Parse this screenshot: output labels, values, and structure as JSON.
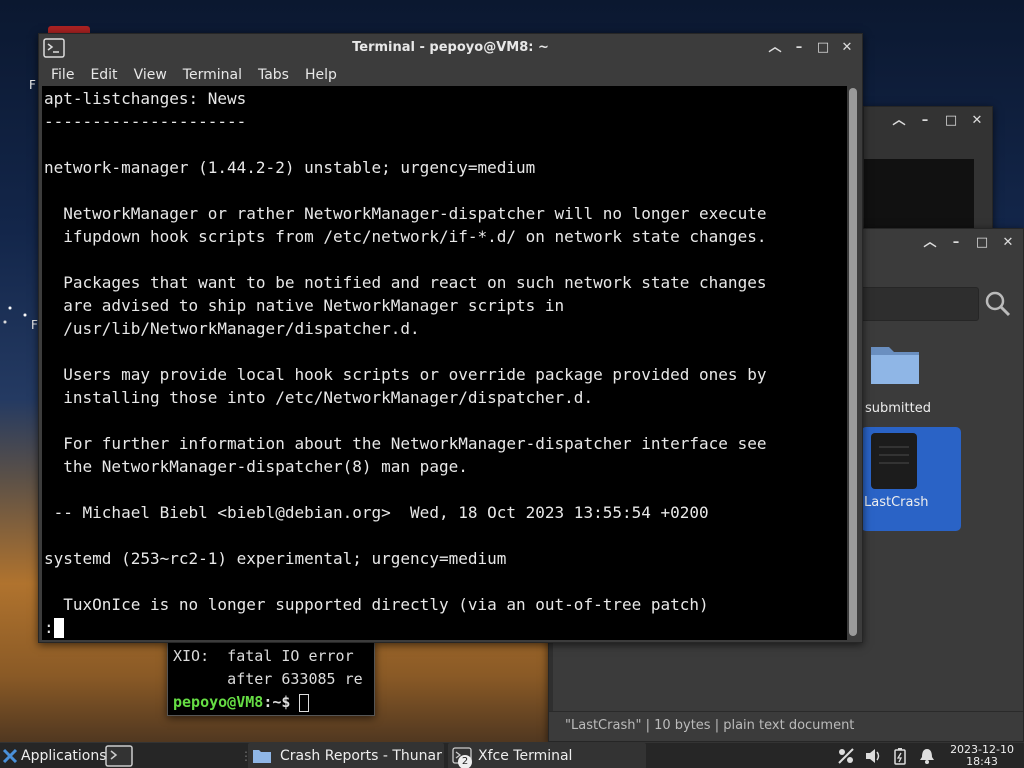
{
  "terminal": {
    "title": "Terminal - pepoyo@VM8: ~",
    "menu": [
      "File",
      "Edit",
      "View",
      "Terminal",
      "Tabs",
      "Help"
    ],
    "lines": [
      "apt-listchanges: News",
      "---------------------",
      "",
      "network-manager (1.44.2-2) unstable; urgency=medium",
      "",
      "  NetworkManager or rather NetworkManager-dispatcher will no longer execute",
      "  ifupdown hook scripts from /etc/network/if-*.d/ on network state changes.",
      "",
      "  Packages that want to be notified and react on such network state changes",
      "  are advised to ship native NetworkManager scripts in",
      "  /usr/lib/NetworkManager/dispatcher.d.",
      "",
      "  Users may provide local hook scripts or override package provided ones by",
      "  installing those into /etc/NetworkManager/dispatcher.d.",
      "",
      "  For further information about the NetworkManager-dispatcher interface see",
      "  the NetworkManager-dispatcher(8) man page.",
      "",
      " -- Michael Biebl <biebl@debian.org>  Wed, 18 Oct 2023 13:55:54 +0200",
      "",
      "systemd (253~rc2-1) experimental; urgency=medium",
      "",
      "  TuxOnIce is no longer supported directly (via an out-of-tree patch)"
    ],
    "prompt": ":"
  },
  "small_terminal": {
    "line1": "XIO:  fatal IO error",
    "line2": "      after 633085 re",
    "prompt_user": "pepoyo@VM8",
    "prompt_sep": ":~$"
  },
  "thunar": {
    "files": [
      {
        "name": "submitted",
        "icon": "folder-icon"
      },
      {
        "name": "LastCrash",
        "icon": "text-file-icon"
      }
    ],
    "status": "\"LastCrash\"  |  10 bytes  |  plain text document"
  },
  "desktop": {
    "letter1": "F",
    "letter2": "F"
  },
  "taskbar": {
    "applications_label": "Applications",
    "tasks": [
      {
        "label": "Crash Reports - Thunar",
        "icon": "folder-icon"
      },
      {
        "label": "Xfce Terminal",
        "icon": "terminal-icon",
        "badge": "2"
      }
    ],
    "clock_date": "2023-12-10",
    "clock_time": "18:43"
  },
  "colors": {
    "prompt_green": "#66dd44",
    "selection_blue": "#2a63c6"
  }
}
